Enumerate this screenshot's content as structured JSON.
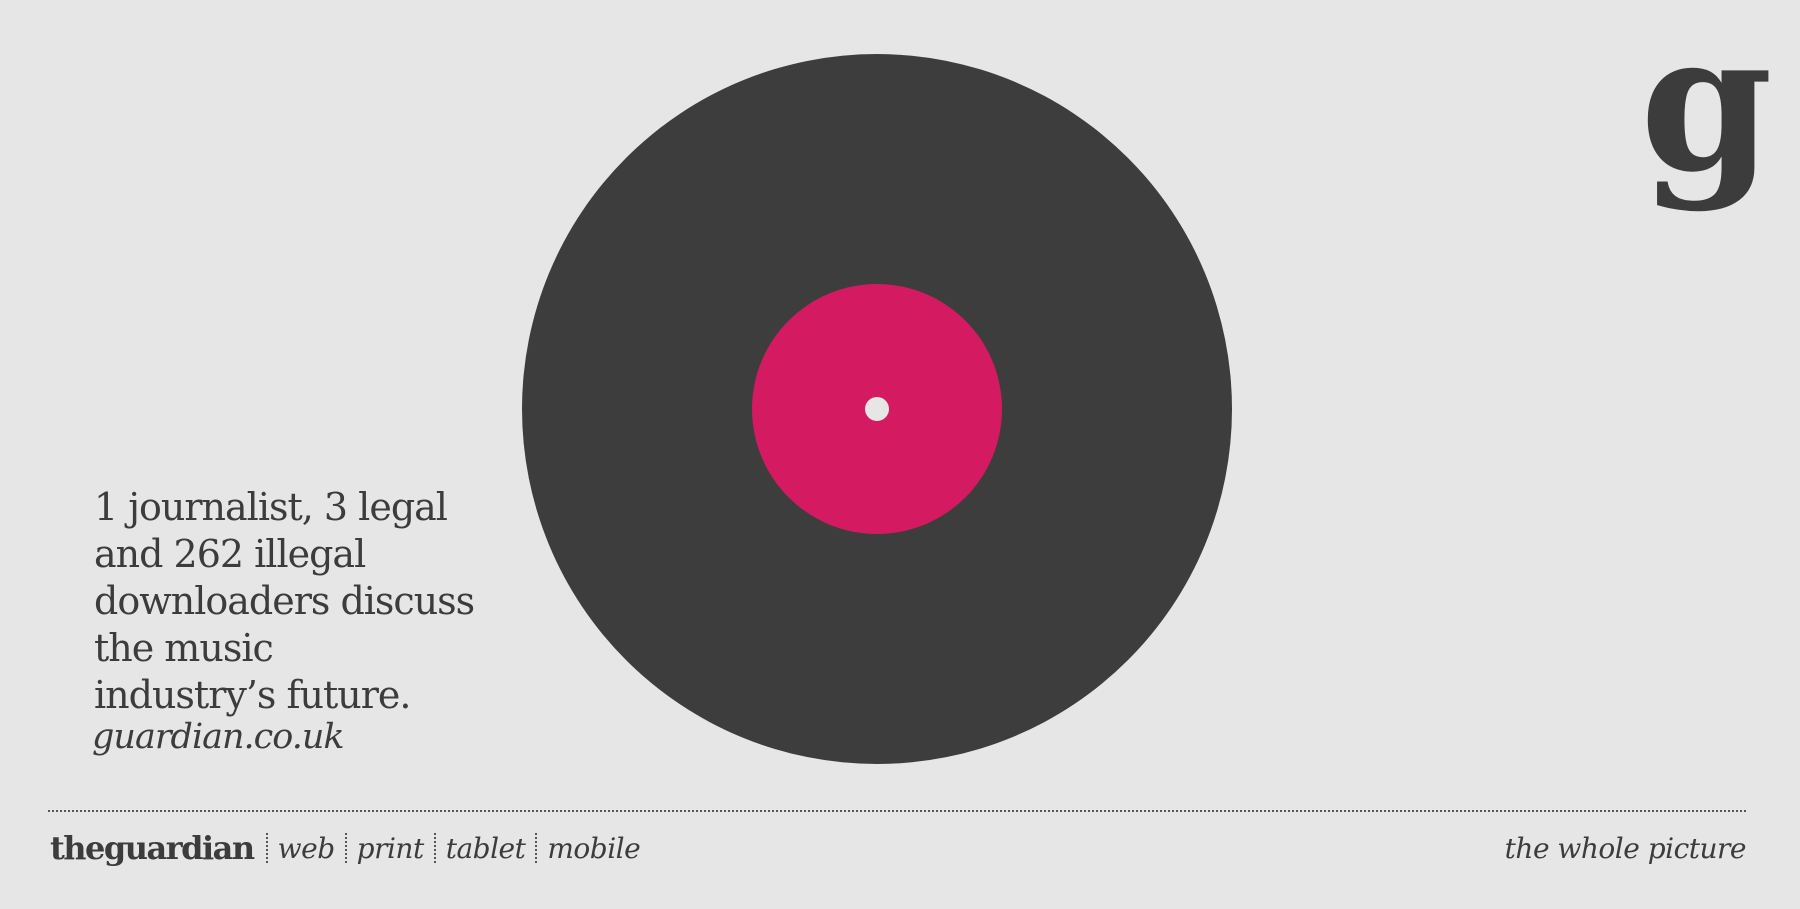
{
  "brand": {
    "logo_letter": "g",
    "wordmark": "theguardian",
    "platforms": [
      "web",
      "print",
      "tablet",
      "mobile"
    ],
    "tagline": "the whole picture"
  },
  "headline": {
    "lines": [
      "1 journalist, 3 legal",
      "and 262 illegal",
      "downloaders discuss",
      "the music",
      "industry’s future."
    ],
    "url": "guardian.co.uk"
  },
  "record": {
    "icon": "vinyl-record-icon",
    "disc_color": "#3d3d3d",
    "label_color": "#d41a60",
    "hole_color": "#e6e6e6"
  },
  "colors": {
    "background": "#e6e6e6",
    "text": "#3c3c3c"
  }
}
